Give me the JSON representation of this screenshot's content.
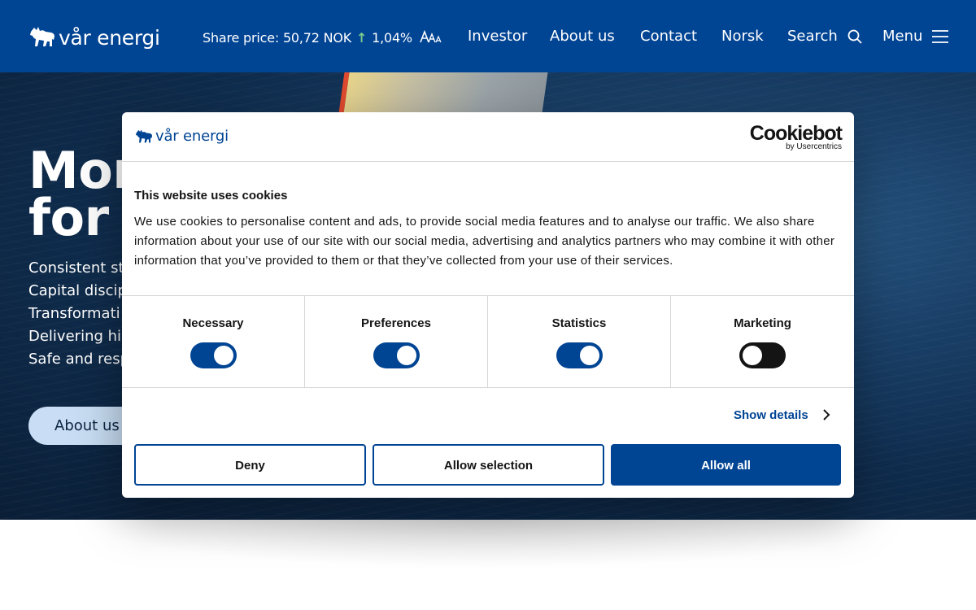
{
  "header": {
    "logo_text": "vår energi",
    "share_price": {
      "label": "Share price: 50,72 NOK",
      "arrow": "↑",
      "change": "1,04%"
    },
    "font_size_icon": "AAA",
    "nav": [
      "Investor",
      "About us",
      "Contact",
      "Norsk"
    ],
    "search_label": "Search",
    "menu_label": "Menu"
  },
  "hero": {
    "title_line1": "Mor",
    "title_line2": "for I",
    "bullets": [
      "Consistent st",
      "Capital discip",
      "Transformati",
      "Delivering hi",
      "Safe and resp"
    ],
    "button_label": "About us"
  },
  "cookie_dialog": {
    "logo_text": "vår energi",
    "brand_main": "Cookiebot",
    "brand_sub": "by Usercentrics",
    "title": "This website uses cookies",
    "text": "We use cookies to personalise content and ads, to provide social media features and to analyse our traffic. We also share information about your use of our site with our social media, advertising and analytics partners who may combine it with other information that you’ve provided to them or that they’ve collected from your use of their services.",
    "categories": [
      {
        "label": "Necessary",
        "enabled": true
      },
      {
        "label": "Preferences",
        "enabled": true
      },
      {
        "label": "Statistics",
        "enabled": true
      },
      {
        "label": "Marketing",
        "enabled": false
      }
    ],
    "show_details": "Show details",
    "buttons": {
      "deny": "Deny",
      "allow_selection": "Allow selection",
      "allow_all": "Allow all"
    }
  },
  "colors": {
    "brand_blue": "#004494",
    "text_dark": "#141414",
    "price_up": "#7ccd8c"
  }
}
